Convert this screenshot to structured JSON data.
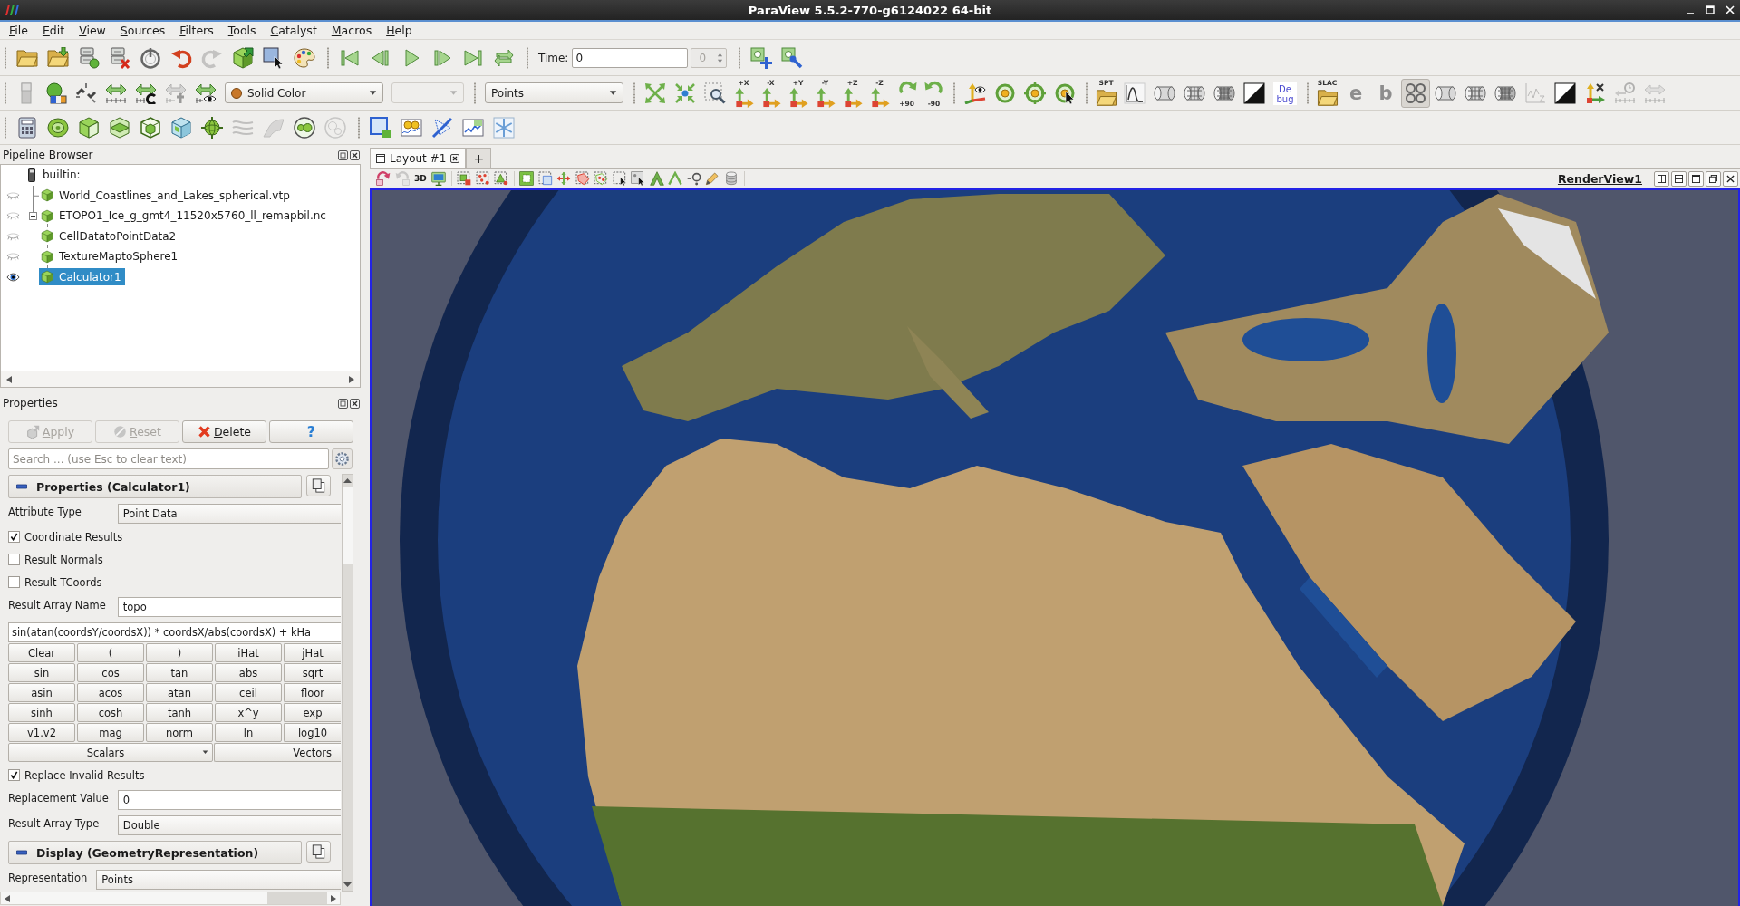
{
  "window": {
    "title": "ParaView 5.5.2-770-g6124022 64-bit"
  },
  "menu": [
    "File",
    "Edit",
    "View",
    "Sources",
    "Filters",
    "Tools",
    "Catalyst",
    "Macros",
    "Help"
  ],
  "toolbars": [
    {
      "groups": [
        {
          "items": [
            {
              "kind": "folder",
              "disabled": false
            },
            {
              "kind": "folderdown",
              "disabled": false
            },
            {
              "kind": "server",
              "disabled": false
            },
            {
              "kind": "serverx",
              "disabled": false
            },
            {
              "kind": "timer",
              "disabled": false
            },
            {
              "kind": "undo",
              "disabled": false
            },
            {
              "kind": "redo",
              "disabled": true
            },
            {
              "kind": "boxarrow",
              "disabled": false
            },
            {
              "kind": "cursorbox",
              "disabled": false
            },
            {
              "kind": "palette",
              "disabled": false
            }
          ]
        },
        {
          "items": [
            {
              "kind": "first",
              "disabled": false
            },
            {
              "kind": "prev",
              "disabled": false
            },
            {
              "kind": "play",
              "disabled": false
            },
            {
              "kind": "next",
              "disabled": false
            },
            {
              "kind": "last",
              "disabled": false
            },
            {
              "kind": "loop",
              "disabled": false
            }
          ]
        },
        {
          "items": [
            {
              "kind": "label",
              "text": "Time:"
            },
            {
              "kind": "field",
              "value": "0"
            },
            {
              "kind": "spinbox",
              "value": "0",
              "disabled": true
            }
          ]
        },
        {
          "items": [
            {
              "kind": "boxplus",
              "disabled": false
            },
            {
              "kind": "boxwrench",
              "disabled": false
            }
          ]
        }
      ]
    },
    {
      "groups": [
        {
          "items": [
            {
              "kind": "colorbar",
              "disabled": true
            },
            {
              "kind": "colormap",
              "disabled": false
            },
            {
              "kind": "chain",
              "disabled": false
            },
            {
              "kind": "rescale",
              "disabled": false
            },
            {
              "kind": "rescalecustom",
              "disabled": false
            },
            {
              "kind": "rescaletime",
              "disabled": true
            },
            {
              "kind": "rescalevisible",
              "disabled": false
            },
            {
              "kind": "colorselect",
              "value": "Solid Color",
              "disabled": false
            },
            {
              "kind": "select",
              "disabled": true
            }
          ]
        },
        {
          "items": [
            {
              "kind": "select",
              "value": "Points",
              "disabled": false
            }
          ]
        },
        {
          "items": [
            {
              "kind": "camreset",
              "disabled": false
            },
            {
              "kind": "zoomclosest",
              "disabled": false
            },
            {
              "kind": "zoombox",
              "disabled": false
            },
            {
              "kind": "axisview",
              "text": "+X",
              "disabled": false
            },
            {
              "kind": "axisview",
              "text": "-X",
              "disabled": false
            },
            {
              "kind": "axisview",
              "text": "+Y",
              "disabled": false
            },
            {
              "kind": "axisview",
              "text": "-Y",
              "disabled": false
            },
            {
              "kind": "axisview",
              "text": "+Z",
              "disabled": false
            },
            {
              "kind": "axisview",
              "text": "-Z",
              "disabled": false
            },
            {
              "kind": "rotcw",
              "text": "+90",
              "disabled": false
            },
            {
              "kind": "rotccw",
              "text": "-90",
              "disabled": false
            }
          ]
        },
        {
          "items": [
            {
              "kind": "axeseye",
              "disabled": false
            },
            {
              "kind": "ringdot",
              "disabled": false
            },
            {
              "kind": "ringcross",
              "disabled": false
            },
            {
              "kind": "ringcursor",
              "disabled": false
            }
          ]
        },
        {
          "items": [
            {
              "kind": "folder",
              "text": "SPT",
              "disabled": false
            },
            {
              "kind": "plotcurve",
              "disabled": false
            },
            {
              "kind": "cylinder",
              "disabled": false
            },
            {
              "kind": "meshcyl",
              "disabled": false
            },
            {
              "kind": "meshcyl2",
              "disabled": false
            },
            {
              "kind": "blackwhite",
              "disabled": false
            },
            {
              "kind": "textbox",
              "text": "De bug",
              "disabled": false
            }
          ]
        },
        {
          "items": [
            {
              "kind": "folder",
              "text": "SLAC",
              "disabled": false,
              "pressed": false
            },
            {
              "kind": "letter",
              "text": "e",
              "disabled": false,
              "pressed": false
            },
            {
              "kind": "letter",
              "text": "b",
              "disabled": false,
              "pressed": false
            },
            {
              "kind": "fourcircles",
              "disabled": false,
              "pressed": true
            },
            {
              "kind": "cylinder",
              "disabled": false,
              "pressed": false
            },
            {
              "kind": "meshcyl",
              "disabled": false,
              "pressed": false
            },
            {
              "kind": "meshcyl2",
              "disabled": false,
              "pressed": false
            },
            {
              "kind": "plotz",
              "disabled": true,
              "pressed": false
            },
            {
              "kind": "blackwhite",
              "disabled": false,
              "pressed": false
            },
            {
              "kind": "axesx",
              "disabled": false,
              "pressed": false
            },
            {
              "kind": "clockruler",
              "disabled": true,
              "pressed": false
            },
            {
              "kind": "rulerarrows",
              "disabled": true,
              "pressed": false
            }
          ]
        }
      ]
    },
    {
      "groups": [
        {
          "items": [
            {
              "kind": "calculator",
              "disabled": false
            },
            {
              "kind": "contour",
              "disabled": false
            },
            {
              "kind": "clip",
              "disabled": false
            },
            {
              "kind": "slice",
              "disabled": false
            },
            {
              "kind": "threshold",
              "disabled": false
            },
            {
              "kind": "extract",
              "disabled": false
            },
            {
              "kind": "glyph",
              "disabled": false
            },
            {
              "kind": "stream",
              "disabled": true
            },
            {
              "kind": "warp",
              "disabled": true
            },
            {
              "kind": "group",
              "disabled": false
            },
            {
              "kind": "extractlevel",
              "disabled": true
            }
          ]
        },
        {
          "items": [
            {
              "kind": "selbox",
              "disabled": false
            },
            {
              "kind": "plotsel",
              "disabled": false
            },
            {
              "kind": "plotline",
              "disabled": false
            },
            {
              "kind": "plotdata",
              "disabled": false
            },
            {
              "kind": "snowflake",
              "disabled": false
            }
          ]
        }
      ]
    }
  ],
  "pipeline": {
    "title": "Pipeline Browser",
    "tree": [
      {
        "label": "builtin:",
        "kind": "server",
        "selected": false,
        "children": [
          {
            "label": "World_Coastlines_and_Lakes_spherical.vtp",
            "kind": "source",
            "visible": false,
            "selected": false
          },
          {
            "label": "ETOPO1_Ice_g_gmt4_11520x5760_ll_remapbil.nc",
            "kind": "source",
            "visible": false,
            "selected": false,
            "expanded": true,
            "children": [
              {
                "label": "CellDatatoPointData2",
                "kind": "source",
                "visible": false,
                "selected": false,
                "children": [
                  {
                    "label": "TextureMaptoSphere1",
                    "kind": "source",
                    "visible": false,
                    "selected": false,
                    "children": [
                      {
                        "label": "Calculator1",
                        "kind": "source",
                        "visible": true,
                        "selected": true
                      }
                    ]
                  }
                ]
              }
            ]
          }
        ]
      }
    ]
  },
  "properties": {
    "title": "Properties",
    "buttons": [
      {
        "label": "Apply",
        "kind": "apply",
        "disabled": true
      },
      {
        "label": "Reset",
        "kind": "reset",
        "disabled": true
      },
      {
        "label": "Delete",
        "kind": "delete",
        "disabled": false
      },
      {
        "label": "?",
        "kind": "help",
        "disabled": false
      }
    ],
    "search": {
      "placeholder": "Search ... (use Esc to clear text)"
    },
    "sections": [
      {
        "title": "Properties (Calculator1)",
        "expanded": true,
        "rows": [
          {
            "kind": "select",
            "label": "Attribute Type",
            "value": "Point Data"
          },
          {
            "kind": "checkbox",
            "label": "Coordinate Results",
            "checked": true
          },
          {
            "kind": "checkbox",
            "label": "Result Normals",
            "checked": false
          },
          {
            "kind": "checkbox",
            "label": "Result TCoords",
            "checked": false
          },
          {
            "kind": "text",
            "label": "Result Array Name",
            "value": "topo"
          },
          {
            "kind": "expression",
            "value": "sin(atan(coordsY/coordsX)) * coordsX/abs(coordsX) + kHa"
          },
          {
            "kind": "keypad",
            "keys": [
              [
                "Clear",
                "(",
                ")",
                "iHat",
                "jHat"
              ],
              [
                "sin",
                "cos",
                "tan",
                "abs",
                "sqrt"
              ],
              [
                "asin",
                "acos",
                "atan",
                "ceil",
                "floor"
              ],
              [
                "sinh",
                "cosh",
                "tanh",
                "x^y",
                "exp"
              ],
              [
                "v1.v2",
                "mag",
                "norm",
                "ln",
                "log10"
              ]
            ],
            "menus": [
              {
                "label": "Scalars",
                "kind": "menu"
              },
              {
                "label": "Vectors",
                "kind": "button"
              }
            ]
          },
          {
            "kind": "checkbox",
            "label": "Replace Invalid Results",
            "checked": true
          },
          {
            "kind": "text",
            "label": "Replacement Value",
            "value": "0"
          },
          {
            "kind": "select",
            "label": "Result Array Type",
            "value": "Double"
          }
        ]
      },
      {
        "title": "Display (GeometryRepresentation)",
        "expanded": true,
        "rows": [
          {
            "kind": "select",
            "label": "Representation",
            "value": "Points"
          }
        ]
      }
    ]
  },
  "layout_tabs": [
    {
      "label": "Layout #1",
      "kind": "tab",
      "selected": true
    },
    {
      "label": "+",
      "kind": "add",
      "selected": false
    }
  ],
  "view_toolbar": {
    "groups": [
      {
        "items": [
          {
            "kind": "camundo",
            "disabled": false
          },
          {
            "kind": "camredo",
            "disabled": true
          },
          {
            "kind": "text",
            "text": "3D",
            "disabled": false
          },
          {
            "kind": "screenshot",
            "disabled": false
          }
        ]
      },
      {
        "items": [
          {
            "kind": "selcells",
            "disabled": false
          },
          {
            "kind": "selpoints",
            "disabled": false
          },
          {
            "kind": "selfrustum",
            "disabled": false
          }
        ]
      },
      {
        "items": [
          {
            "kind": "selblock",
            "disabled": false
          },
          {
            "kind": "seldashed",
            "disabled": false
          },
          {
            "kind": "selarrows",
            "disabled": false
          },
          {
            "kind": "selpoly",
            "disabled": false
          },
          {
            "kind": "selpolypts",
            "disabled": false
          },
          {
            "kind": "hover",
            "disabled": false
          },
          {
            "kind": "hoverpts",
            "disabled": false
          },
          {
            "kind": "grow",
            "disabled": false
          },
          {
            "kind": "shrink",
            "disabled": false
          },
          {
            "kind": "query",
            "disabled": false
          },
          {
            "kind": "pencil",
            "disabled": false
          },
          {
            "kind": "database",
            "disabled": false
          }
        ]
      }
    ]
  },
  "view_title": "RenderView1"
}
